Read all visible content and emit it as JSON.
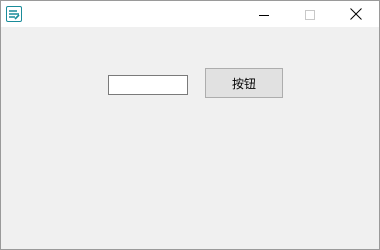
{
  "window": {
    "title": "",
    "app_icon": "app-icon",
    "controls": {
      "minimize_icon": "minimize-icon",
      "maximize_icon": "maximize-icon",
      "close_icon": "close-icon"
    }
  },
  "form": {
    "text_input_value": "",
    "button_label": "按钮"
  },
  "colors": {
    "client_background": "#f0f0f0",
    "titlebar_background": "#ffffff",
    "button_background": "#e1e1e1",
    "button_border": "#adadad",
    "icon_accent": "#1a8c9a"
  }
}
